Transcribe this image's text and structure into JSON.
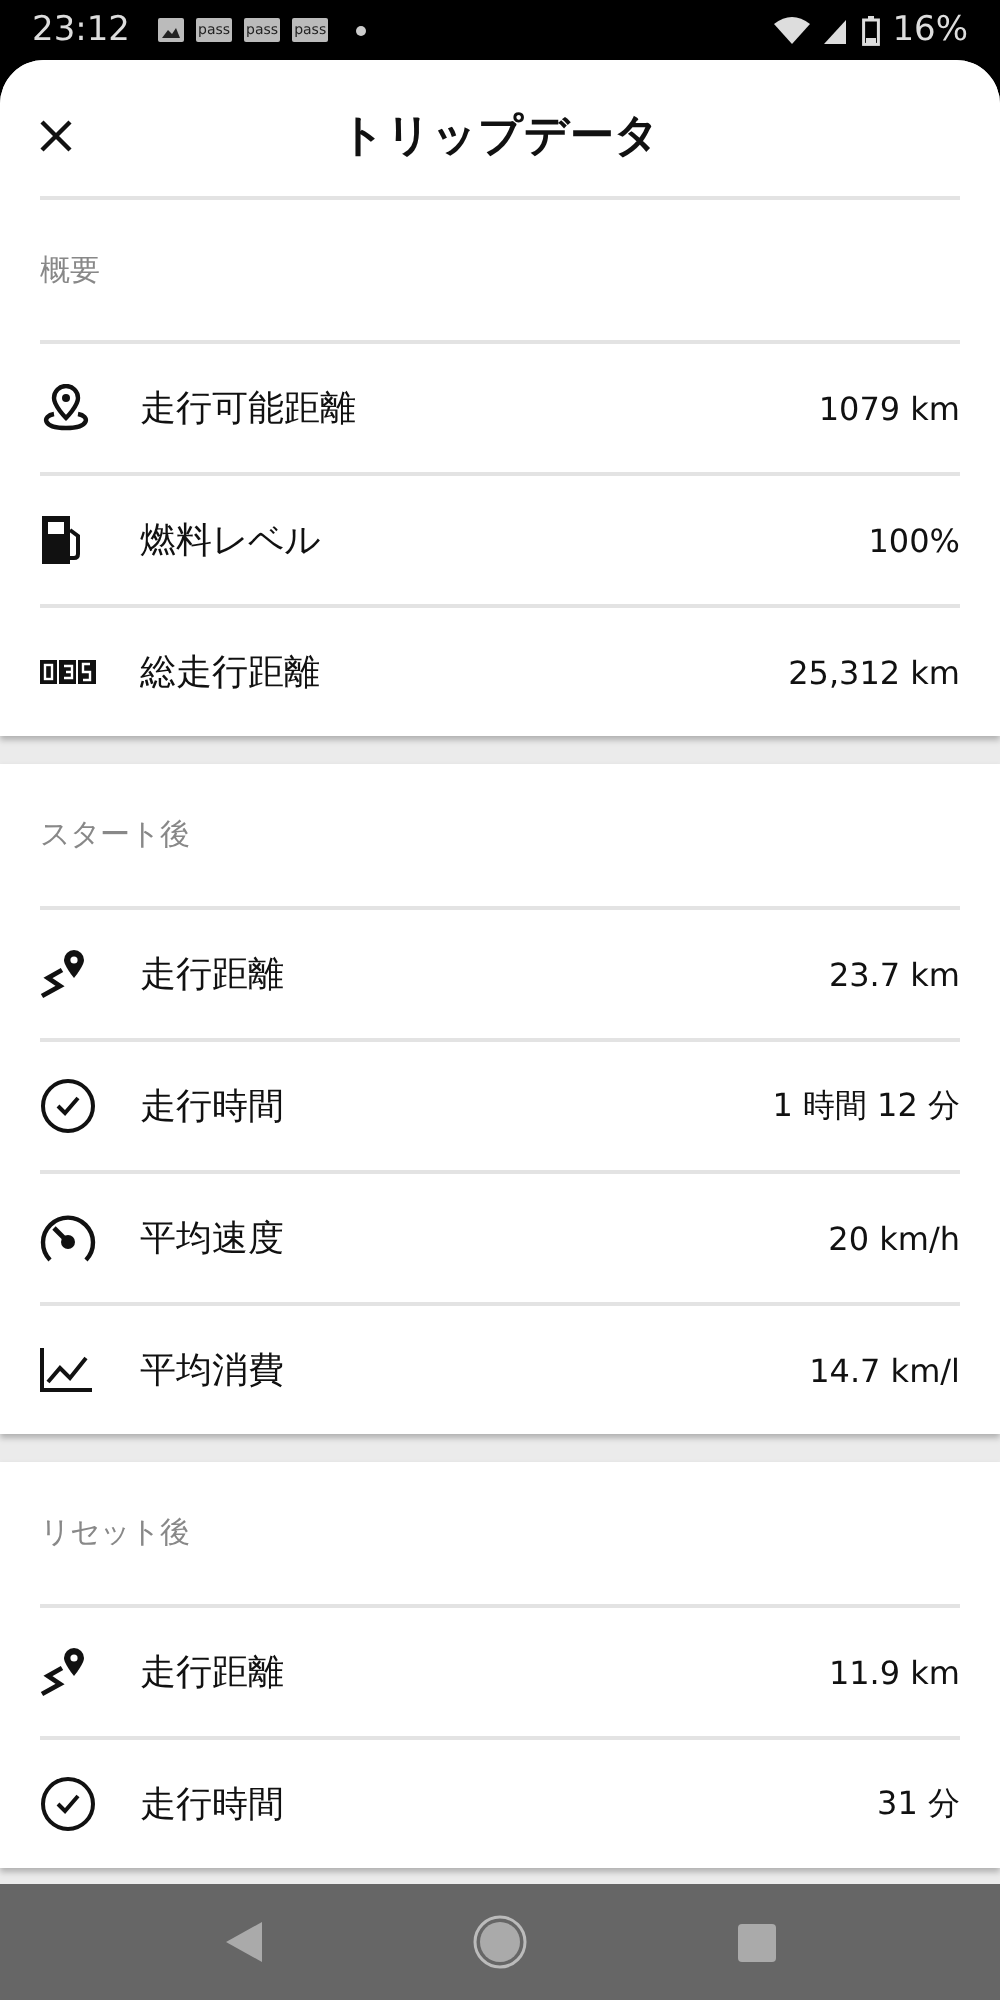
{
  "status_bar": {
    "time": "23:12",
    "notifications": [
      "pass",
      "pass",
      "pass"
    ],
    "battery": "16%"
  },
  "sheet": {
    "title": "トリップデータ"
  },
  "sections": [
    {
      "title": "概要",
      "rows": [
        {
          "kind": "range",
          "label": "走行可能距離",
          "value": "1079 km"
        },
        {
          "kind": "fuel",
          "label": "燃料レベル",
          "value": "100%"
        },
        {
          "kind": "odometer",
          "label": "総走行距離",
          "value": "25,312 km"
        }
      ]
    },
    {
      "title": "スタート後",
      "rows": [
        {
          "kind": "route",
          "label": "走行距離",
          "value": "23.7 km"
        },
        {
          "kind": "clock",
          "label": "走行時間",
          "value": "1 時間 12 分"
        },
        {
          "kind": "speed",
          "label": "平均速度",
          "value": "20 km/h"
        },
        {
          "kind": "chart",
          "label": "平均消費",
          "value": "14.7 km/l"
        }
      ]
    },
    {
      "title": "リセット後",
      "rows": [
        {
          "kind": "route",
          "label": "走行距離",
          "value": "11.9 km"
        },
        {
          "kind": "clock",
          "label": "走行時間",
          "value": "31 分"
        }
      ]
    }
  ]
}
